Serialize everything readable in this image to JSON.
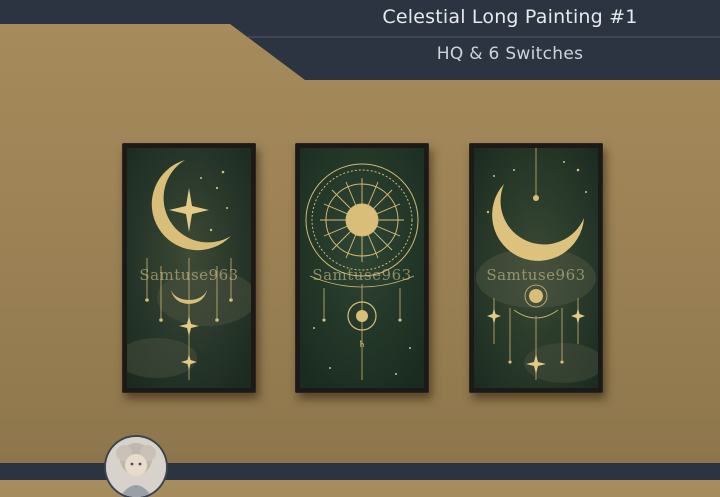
{
  "header": {
    "title": "Celestial Long Painting #1",
    "subtitle": "HQ & 6 Switches"
  },
  "paintings": [
    {
      "name": "crescent-moon-star-painting",
      "watermark": "Samtuse963"
    },
    {
      "name": "sun-mandala-painting",
      "watermark": "Samtuse963"
    },
    {
      "name": "large-crescent-painting",
      "watermark": "Samtuse963"
    }
  ],
  "colors": {
    "wall": "#a78c5c",
    "banner": "#2c3441",
    "painting_bg": "#243524",
    "gold": "#d9c07a",
    "frame": "#1b1a17"
  },
  "icons": {
    "avatar": "doll-portrait-avatar"
  }
}
